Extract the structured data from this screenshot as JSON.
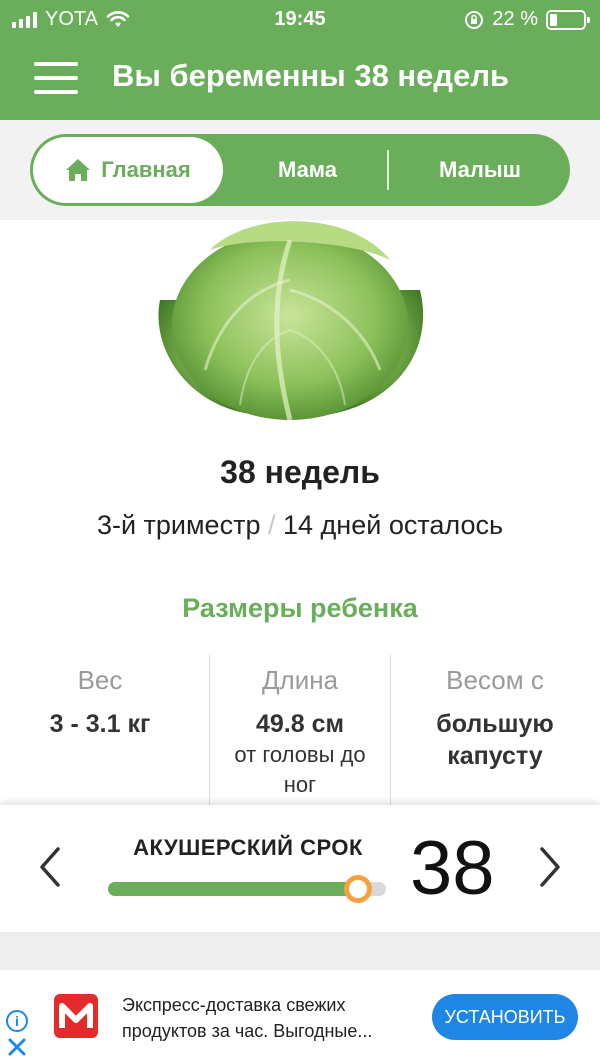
{
  "status_bar": {
    "carrier": "YOTA",
    "time": "19:45",
    "battery_percent": "22 %",
    "battery_level": 0.22
  },
  "header": {
    "title": "Вы беременны 38 недель",
    "menu_icon": "hamburger-menu-icon",
    "background": "#6aae5c"
  },
  "tabs": [
    {
      "label": "Главная",
      "icon": "home-icon",
      "active": true
    },
    {
      "label": "Мама",
      "active": false
    },
    {
      "label": "Малыш",
      "active": false
    }
  ],
  "week": {
    "title": "38 недель",
    "trimester": "3-й триместр",
    "separator": "/",
    "remaining": "14 дней осталось"
  },
  "sizes": {
    "title": "Размеры ребенка",
    "weight_label": "Вес",
    "weight_value": "3 - 3.1 кг",
    "length_label": "Длина",
    "length_value": "49.8 см",
    "length_note": "от головы до ног",
    "compare_label": "Весом с",
    "compare_value": "большую капусту"
  },
  "term_slider": {
    "label": "АКУШЕРСКИЙ СРОК",
    "value": "38",
    "progress": 0.9
  },
  "ad": {
    "line1": "Экспресс-доставка свежих",
    "line2": "продуктов за час. Выгодные...",
    "button": "УСТАНОВИТЬ",
    "logo_icon": "magnit-logo-icon"
  },
  "colors": {
    "accent": "#6aae5c",
    "slider_thumb": "#f5a142",
    "ad_button": "#1f86e6"
  }
}
